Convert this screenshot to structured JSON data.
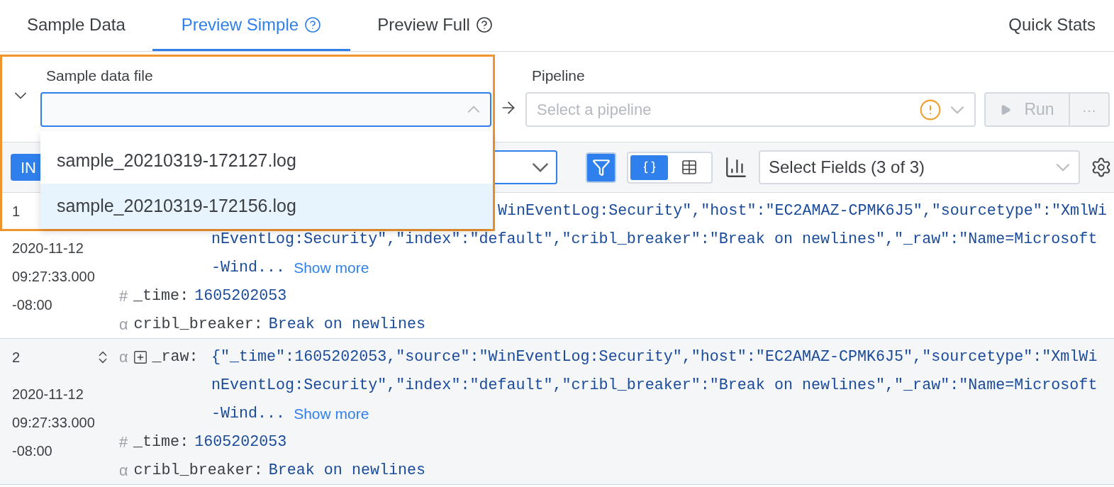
{
  "tabs": [
    {
      "label": "Sample Data",
      "help": false,
      "selected": false
    },
    {
      "label": "Preview Simple",
      "help": true,
      "selected": true
    },
    {
      "label": "Preview Full",
      "help": true,
      "selected": false
    },
    {
      "label": "Quick Stats",
      "help": false,
      "selected": false
    }
  ],
  "sample_file": {
    "label": "Sample data file",
    "expanded": true,
    "options": [
      {
        "label": "sample_20210319-172127.log",
        "selected": false
      },
      {
        "label": "sample_20210319-172156.log",
        "selected": true
      }
    ]
  },
  "pipeline": {
    "label": "Pipeline",
    "placeholder": "Select a pipeline",
    "warning": true
  },
  "run_button": {
    "label": "Run",
    "disabled": true
  },
  "more_button": {
    "label": "···"
  },
  "toolbar": {
    "mode_button": "IN",
    "filter_on": true,
    "views": [
      {
        "kind": "json",
        "selected": true
      },
      {
        "kind": "table",
        "selected": false
      }
    ],
    "fields_select": "Select Fields (3 of 3)"
  },
  "events": [
    {
      "number": "1",
      "timestamp": [
        "2020-11-12",
        "09:27:33.000",
        "-08:00"
      ],
      "fields": [
        {
          "kind": "raw",
          "lines": [
            "WinEventLog:Security\",\"host\":\"EC2AMAZ-CPMK6J5\",\"sourcetype\":\"XmlWi",
            "nEventLog:Security\",\"index\":\"default\",\"cribl_breaker\":\"Break on newlines\",\"_raw\":\"Name=Microsoft",
            "-Wind..."
          ],
          "more": "Show more"
        },
        {
          "kind": "number",
          "key": "_time:",
          "type_mark": "#",
          "value": "1605202053"
        },
        {
          "kind": "string",
          "key": "cribl_breaker:",
          "type_mark": "α",
          "value": "Break on newlines"
        }
      ]
    },
    {
      "number": "2",
      "toggle": true,
      "timestamp": [
        "2020-11-12",
        "09:27:33.000",
        "-08:00"
      ],
      "fields": [
        {
          "kind": "raw",
          "key": "_raw:",
          "type_mark": "α",
          "lines": [
            "{\"_time\":1605202053,\"source\":\"WinEventLog:Security\",\"host\":\"EC2AMAZ-CPMK6J5\",\"sourcetype\":\"XmlWi",
            "nEventLog:Security\",\"index\":\"default\",\"cribl_breaker\":\"Break on newlines\",\"_raw\":\"Name=Microsoft",
            "-Wind..."
          ],
          "more": "Show more"
        },
        {
          "kind": "number",
          "key": "_time:",
          "type_mark": "#",
          "value": "1605202053"
        },
        {
          "kind": "string",
          "key": "cribl_breaker:",
          "type_mark": "α",
          "value": "Break on newlines"
        }
      ]
    }
  ]
}
